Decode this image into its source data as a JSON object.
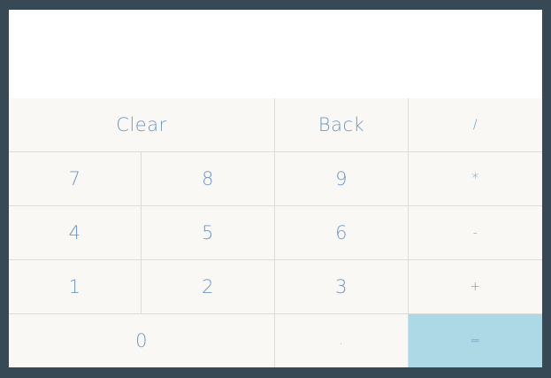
{
  "display": {
    "value": ""
  },
  "keys": {
    "clear": "Clear",
    "back": "Back",
    "divide": "/",
    "seven": "7",
    "eight": "8",
    "nine": "9",
    "multiply": "*",
    "four": "4",
    "five": "5",
    "six": "6",
    "subtract": "-",
    "one": "1",
    "two": "2",
    "three": "3",
    "add": "+",
    "zero": "0",
    "decimal": ".",
    "equals": "="
  },
  "colors": {
    "frame": "#374955",
    "key_background": "#faf8f5",
    "key_text": "#6f98c4",
    "equals_background": "#add8e6",
    "grid_lines": "#dcdcd8"
  }
}
